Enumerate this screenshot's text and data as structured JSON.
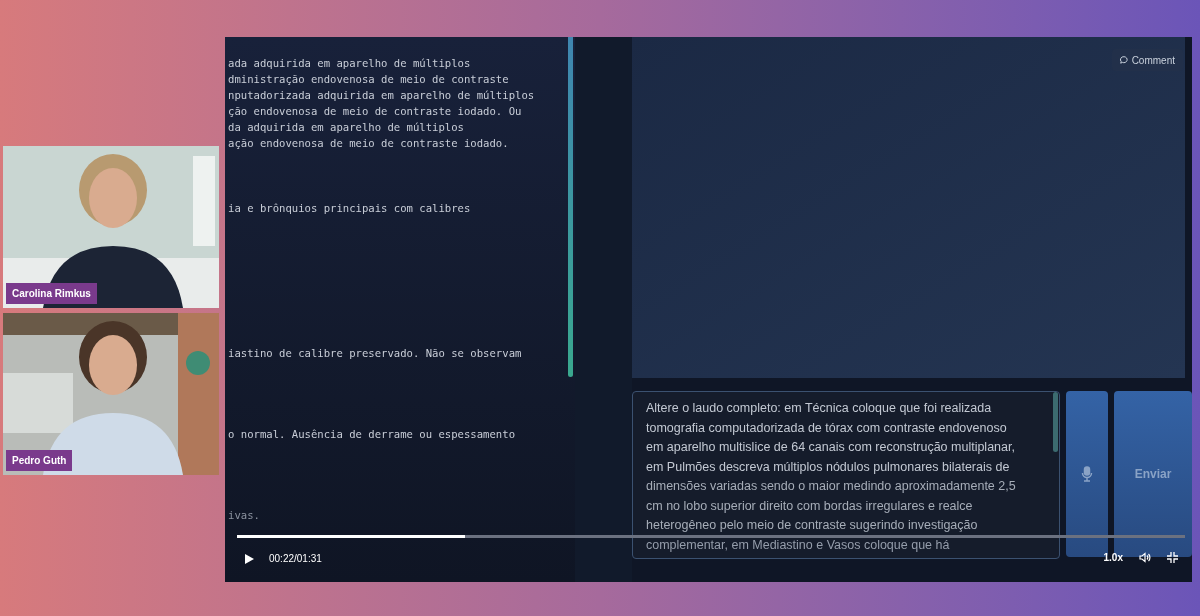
{
  "participants": [
    {
      "name": "Carolina Rimkus"
    },
    {
      "name": "Pedro Guth"
    }
  ],
  "report_lines": [
    "ada adquirida em aparelho de múltiplos",
    "dministração endovenosa de meio de contraste",
    "nputadorizada adquirida em aparelho de múltiplos",
    "ção endovenosa de meio de contraste iodado. Ou",
    "da adquirida em aparelho de múltiplos",
    "ação endovenosa de meio de contraste iodado.",
    "ia e brônquios principais com calibres",
    "iastino de calibre preservado. Não se observam",
    "o normal. Ausência de derrame ou espessamento",
    "ivas."
  ],
  "comment_button": "Comment",
  "prompt_lines": [
    "Altere o laudo completo: em Técnica coloque que foi realizada",
    "tomografia computadorizada de tórax com contraste endovenoso",
    "em aparelho multislice de 64 canais com reconstrução multiplanar,",
    "em Pulmões descreva múltiplos nódulos pulmonares bilaterais de",
    "dimensões variadas sendo o maior medindo aproximadamente 2,5",
    "cm no lobo superior direito com bordas irregulares e realce",
    "heterogêneo pelo meio de contraste sugerindo investigação",
    "complementar, em Mediastino e Vasos coloque que há"
  ],
  "send_button": "Enviar",
  "player": {
    "playing": false,
    "level": 0.24,
    "time": "00:22/01:31",
    "speed": "1.0x"
  }
}
